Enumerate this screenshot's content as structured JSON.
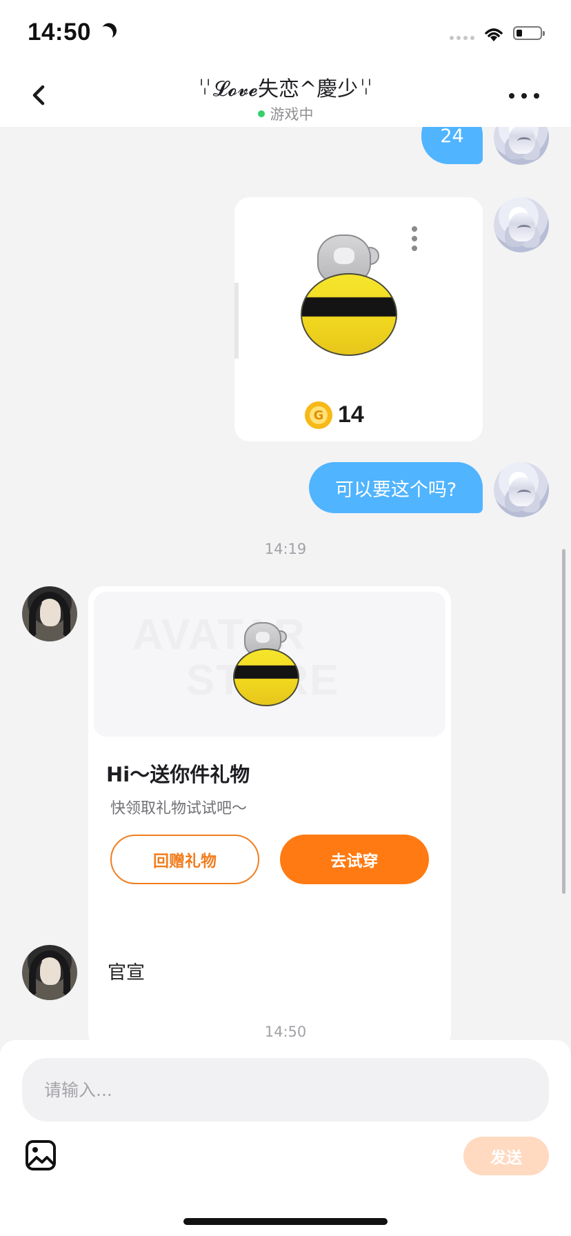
{
  "status_bar": {
    "time": "14:50"
  },
  "header": {
    "title": "ꈌ𝓛𝓸𝓿𝓮失恋^慶少ꈌ",
    "status": "游戏中"
  },
  "messages": [
    {
      "type": "text",
      "side": "outgoing",
      "text": "24"
    },
    {
      "type": "item_card",
      "side": "outgoing",
      "price": "14",
      "coin_symbol": "G"
    },
    {
      "type": "text",
      "side": "outgoing",
      "text": "可以要这个吗?"
    },
    {
      "type": "timestamp",
      "text": "14:19"
    },
    {
      "type": "gift_card",
      "side": "incoming",
      "title": "Hi～送你件礼物",
      "subtitle": "快领取礼物试试吧～",
      "return_gift_label": "回赠礼物",
      "try_on_label": "去试穿"
    },
    {
      "type": "text",
      "side": "incoming",
      "text": "官宣"
    },
    {
      "type": "timestamp",
      "text": "14:50"
    }
  ],
  "composer": {
    "placeholder": "请输入...",
    "send_label": "发送"
  },
  "colors": {
    "outgoing_bubble": "#50b4ff",
    "accent_orange": "#ff7a12",
    "online_green": "#35d06b"
  }
}
